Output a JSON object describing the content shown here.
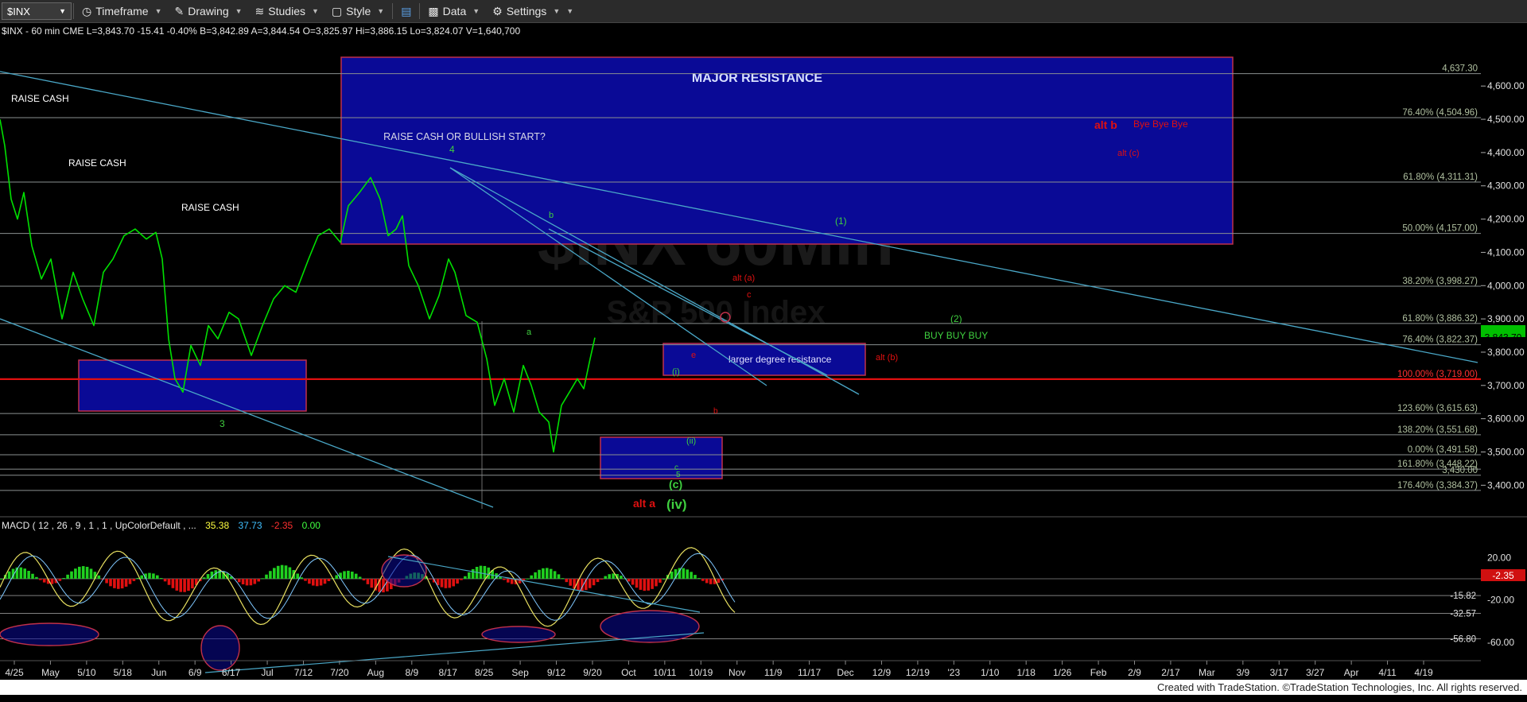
{
  "toolbar": {
    "symbol": "$INX",
    "timeframe": "Timeframe",
    "drawing": "Drawing",
    "studies": "Studies",
    "style": "Style",
    "data": "Data",
    "settings": "Settings"
  },
  "header": {
    "symbol_line": "$INX - 60 min  CME  L=3,843.70  -15.41  -0.40%  B=3,842.89  A=3,844.54  O=3,825.97  Hi=3,886.15  Lo=3,824.07  V=1,640,700"
  },
  "watermark": {
    "line1": "$INX 60Min",
    "line2": "S&P 500 Index"
  },
  "macd_header": {
    "label": "MACD ( 12 , 26 , 9 , 1 , 1 , UpColorDefault , ...",
    "v1": "35.38",
    "v2": "37.73",
    "v3": "-2.35",
    "v4": "0.00"
  },
  "footer": "Created with TradeStation. ©TradeStation Technologies, Inc. All rights reserved.",
  "colors": {
    "price": "#00e000",
    "resistance_box": "#0a0a96",
    "box_border": "#c0304a",
    "label_red": "#e01010",
    "label_green": "#3fcf3f",
    "fib_line": "#9aa090",
    "trend": "#4aa8c8"
  },
  "chart_data": [
    {
      "type": "line",
      "title": "",
      "series": [
        {
          "name": "$INX 60 min"
        }
      ],
      "ylim": [
        3310,
        4720
      ],
      "yticks": [
        "4,600.00",
        "4,500.00",
        "4,400.00",
        "4,300.00",
        "4,200.00",
        "4,100.00",
        "4,000.00",
        "3,900.00",
        "3,800.00",
        "3,700.00",
        "3,600.00",
        "3,500.00",
        "3,400.00"
      ],
      "ytick_values": [
        4600,
        4500,
        4400,
        4300,
        4200,
        4100,
        4000,
        3900,
        3800,
        3700,
        3600,
        3500,
        3400
      ],
      "xticks": [
        "4/25",
        "May",
        "5/10",
        "5/18",
        "Jun",
        "6/9",
        "6/17",
        "Jul",
        "7/12",
        "7/20",
        "Aug",
        "8/9",
        "8/17",
        "8/25",
        "Sep",
        "9/12",
        "9/20",
        "Oct",
        "10/11",
        "10/19",
        "Nov",
        "11/9",
        "11/17",
        "Dec",
        "12/9",
        "12/19",
        "'23",
        "1/10",
        "1/18",
        "1/26",
        "Feb",
        "2/9",
        "2/17",
        "Mar",
        "3/9",
        "3/17",
        "3/27",
        "Apr",
        "4/11",
        "4/19"
      ],
      "last_price": "3,843.70",
      "last_value": 3843.7,
      "price_path": [
        [
          0,
          4500
        ],
        [
          6,
          4420
        ],
        [
          14,
          4260
        ],
        [
          22,
          4200
        ],
        [
          30,
          4280
        ],
        [
          40,
          4120
        ],
        [
          52,
          4020
        ],
        [
          64,
          4080
        ],
        [
          78,
          3900
        ],
        [
          92,
          4040
        ],
        [
          104,
          3960
        ],
        [
          118,
          3880
        ],
        [
          130,
          4040
        ],
        [
          142,
          4080
        ],
        [
          156,
          4150
        ],
        [
          170,
          4170
        ],
        [
          184,
          4140
        ],
        [
          196,
          4160
        ],
        [
          204,
          4080
        ],
        [
          212,
          3840
        ],
        [
          220,
          3720
        ],
        [
          230,
          3680
        ],
        [
          240,
          3820
        ],
        [
          252,
          3760
        ],
        [
          262,
          3880
        ],
        [
          274,
          3840
        ],
        [
          288,
          3920
        ],
        [
          300,
          3900
        ],
        [
          316,
          3790
        ],
        [
          330,
          3880
        ],
        [
          344,
          3960
        ],
        [
          358,
          4000
        ],
        [
          372,
          3980
        ],
        [
          388,
          4080
        ],
        [
          400,
          4150
        ],
        [
          414,
          4170
        ],
        [
          428,
          4130
        ],
        [
          438,
          4240
        ],
        [
          452,
          4280
        ],
        [
          466,
          4325
        ],
        [
          478,
          4260
        ],
        [
          488,
          4150
        ],
        [
          498,
          4170
        ],
        [
          506,
          4210
        ],
        [
          514,
          4060
        ],
        [
          526,
          4000
        ],
        [
          540,
          3900
        ],
        [
          552,
          3970
        ],
        [
          564,
          4080
        ],
        [
          572,
          4040
        ],
        [
          586,
          3910
        ],
        [
          600,
          3890
        ],
        [
          612,
          3780
        ],
        [
          622,
          3640
        ],
        [
          634,
          3720
        ],
        [
          646,
          3620
        ],
        [
          658,
          3760
        ],
        [
          668,
          3700
        ],
        [
          678,
          3620
        ],
        [
          690,
          3590
        ],
        [
          696,
          3500
        ],
        [
          706,
          3640
        ],
        [
          716,
          3680
        ],
        [
          726,
          3720
        ],
        [
          734,
          3690
        ],
        [
          742,
          3780
        ],
        [
          748,
          3843.7
        ]
      ]
    },
    {
      "type": "line",
      "title": "MACD",
      "values_shown": {
        "macd": 35.38,
        "signal": 37.73,
        "diff": -2.35,
        "zero": 0.0
      },
      "yticks": [
        "20.00",
        "-20.00",
        "-60.00"
      ],
      "ytick_values": [
        20,
        -20,
        -60
      ],
      "levels": [
        "-15.82",
        "-32.57",
        "-56.80"
      ],
      "level_values": [
        -15.82,
        -32.57,
        -56.8
      ],
      "last_diff": "-2.35"
    }
  ],
  "fib_levels": [
    {
      "label": "4,637.30",
      "value": 4637.3,
      "side": "top"
    },
    {
      "label": "76.40% (4,504.96)",
      "value": 4504.96
    },
    {
      "label": "61.80% (4,311.31)",
      "value": 4311.31
    },
    {
      "label": "50.00% (4,157.00)",
      "value": 4157
    },
    {
      "label": "38.20% (3,998.27)",
      "value": 3998.27
    },
    {
      "label": "61.80% (3,886.32)",
      "value": 3886.32
    },
    {
      "label": "76.40% (3,822.37)",
      "value": 3822.37
    },
    {
      "label": "100.00% (3,719.00)",
      "value": 3719,
      "red": true
    },
    {
      "label": "123.60% (3,615.63)",
      "value": 3615.63
    },
    {
      "label": "138.20% (3,551.68)",
      "value": 3551.68
    },
    {
      "label": "0.00% (3,491.58)",
      "value": 3491.58
    },
    {
      "label": "161.80% (3,448.22)",
      "value": 3448.22
    },
    {
      "label": "3,430.00",
      "value": 3430
    },
    {
      "label": "176.40% (3,384.37)",
      "value": 3384.37
    }
  ],
  "annotations": {
    "major_resistance": "MAJOR RESISTANCE",
    "raise_cash_bullish": "RAISE CASH OR BULLISH START?",
    "raise_cash_1": "RAISE CASH",
    "raise_cash_2": "RAISE CASH",
    "raise_cash_3": "RAISE CASH",
    "alt_b": "alt b",
    "bye": "Bye Bye Bye",
    "alt_c": "alt (c)",
    "larger_degree": "larger degree resistance",
    "alt_b_small": "alt (b)",
    "buy": "BUY BUY BUY",
    "w2": "(2)",
    "w1": "(1)",
    "alt_a_big": "alt a",
    "iv": "(iv)",
    "c_big": "(c)",
    "alt_a_small": "alt (a)",
    "c_small": "c",
    "b_small": "b",
    "a_small": "a",
    "e_small": "e",
    "i_small": "(i)",
    "ii_small": "(ii)",
    "w4": "4",
    "w3": "3",
    "c_low": "c",
    "five": "5",
    "b_red": "b"
  }
}
